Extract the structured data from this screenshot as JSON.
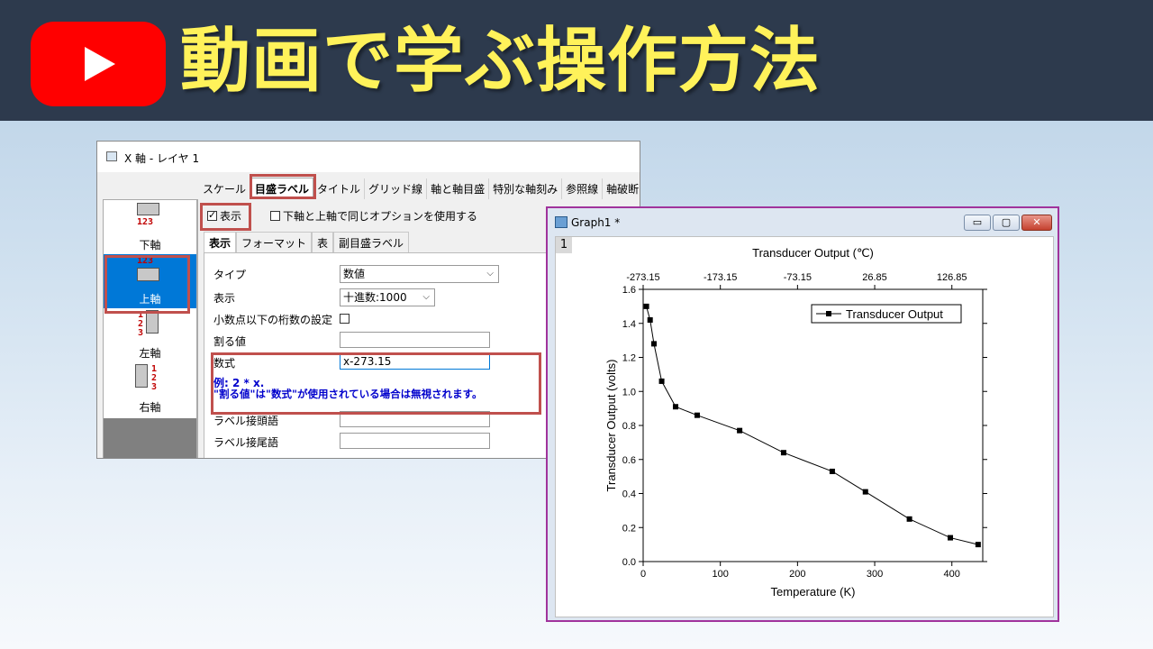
{
  "banner": {
    "title": "動画で学ぶ操作方法",
    "icon": "youtube-play-icon",
    "colors": {
      "background": "#2d3a4d",
      "title": "#fff25a",
      "logo": "#ff0000"
    }
  },
  "dialog": {
    "title": "X 軸 - レイヤ 1",
    "tabs": [
      "スケール",
      "目盛ラベル",
      "タイトル",
      "グリッド線",
      "軸と軸目盛",
      "特別な軸刻み",
      "参照線",
      "軸破断"
    ],
    "active_tab": "目盛ラベル",
    "axes": [
      {
        "label": "下軸",
        "numbers": "123"
      },
      {
        "label": "上軸",
        "numbers": "123"
      },
      {
        "label": "左軸",
        "numbers": "123"
      },
      {
        "label": "右軸",
        "numbers": "123"
      }
    ],
    "selected_axis": "上軸",
    "show_label": "表示",
    "same_option_label": "下軸と上軸で同じオプションを使用する",
    "subtabs": [
      "表示",
      "フォーマット",
      "表",
      "副目盛ラベル"
    ],
    "active_subtab": "表示",
    "rows": {
      "type_label": "タイプ",
      "type_value": "数値",
      "display_label": "表示",
      "display_value": "十進数:1000",
      "decimals_label": "小数点以下の桁数の設定",
      "divide_label": "割る値",
      "divide_value": "",
      "formula_label": "数式",
      "formula_value": "x-273.15",
      "hint_line1": "例: 2 * x.",
      "hint_line2": "\"割る値\"は\"数式\"が使用されている場合は無視されます。",
      "prefix_label": "ラベル接頭語",
      "suffix_label": "ラベル接尾語"
    }
  },
  "graph": {
    "window_title": "Graph1 *",
    "page_number": "1",
    "buttons": {
      "minimize": "▭",
      "restore": "▢",
      "close": "✕"
    }
  },
  "chart_data": {
    "type": "line",
    "title": "",
    "xlabel": "Temperature (K)",
    "ylabel": "Transducer Output (volts)",
    "top_xlabel": "Transducer Output (℃)",
    "xlim": [
      0,
      440
    ],
    "ylim": [
      0.0,
      1.6
    ],
    "xticks": [
      0,
      100,
      200,
      300,
      400
    ],
    "yticks": [
      0.0,
      0.2,
      0.4,
      0.6,
      0.8,
      1.0,
      1.2,
      1.4,
      1.6
    ],
    "top_xtick_labels": [
      "-273.15",
      "-173.15",
      "-73.15",
      "26.85",
      "126.85"
    ],
    "top_xtick_values": [
      0,
      100,
      200,
      300,
      400
    ],
    "legend": "top-right",
    "series": [
      {
        "name": "Transducer Output",
        "marker": "square",
        "x": [
          4.2,
          9,
          14,
          24,
          42,
          70,
          125,
          182,
          245,
          288,
          345,
          398,
          434
        ],
        "values": [
          1.5,
          1.42,
          1.28,
          1.06,
          0.91,
          0.86,
          0.77,
          0.64,
          0.53,
          0.41,
          0.25,
          0.14,
          0.1
        ]
      }
    ],
    "colors": {
      "line": "#000000",
      "marker": "#000000"
    }
  }
}
